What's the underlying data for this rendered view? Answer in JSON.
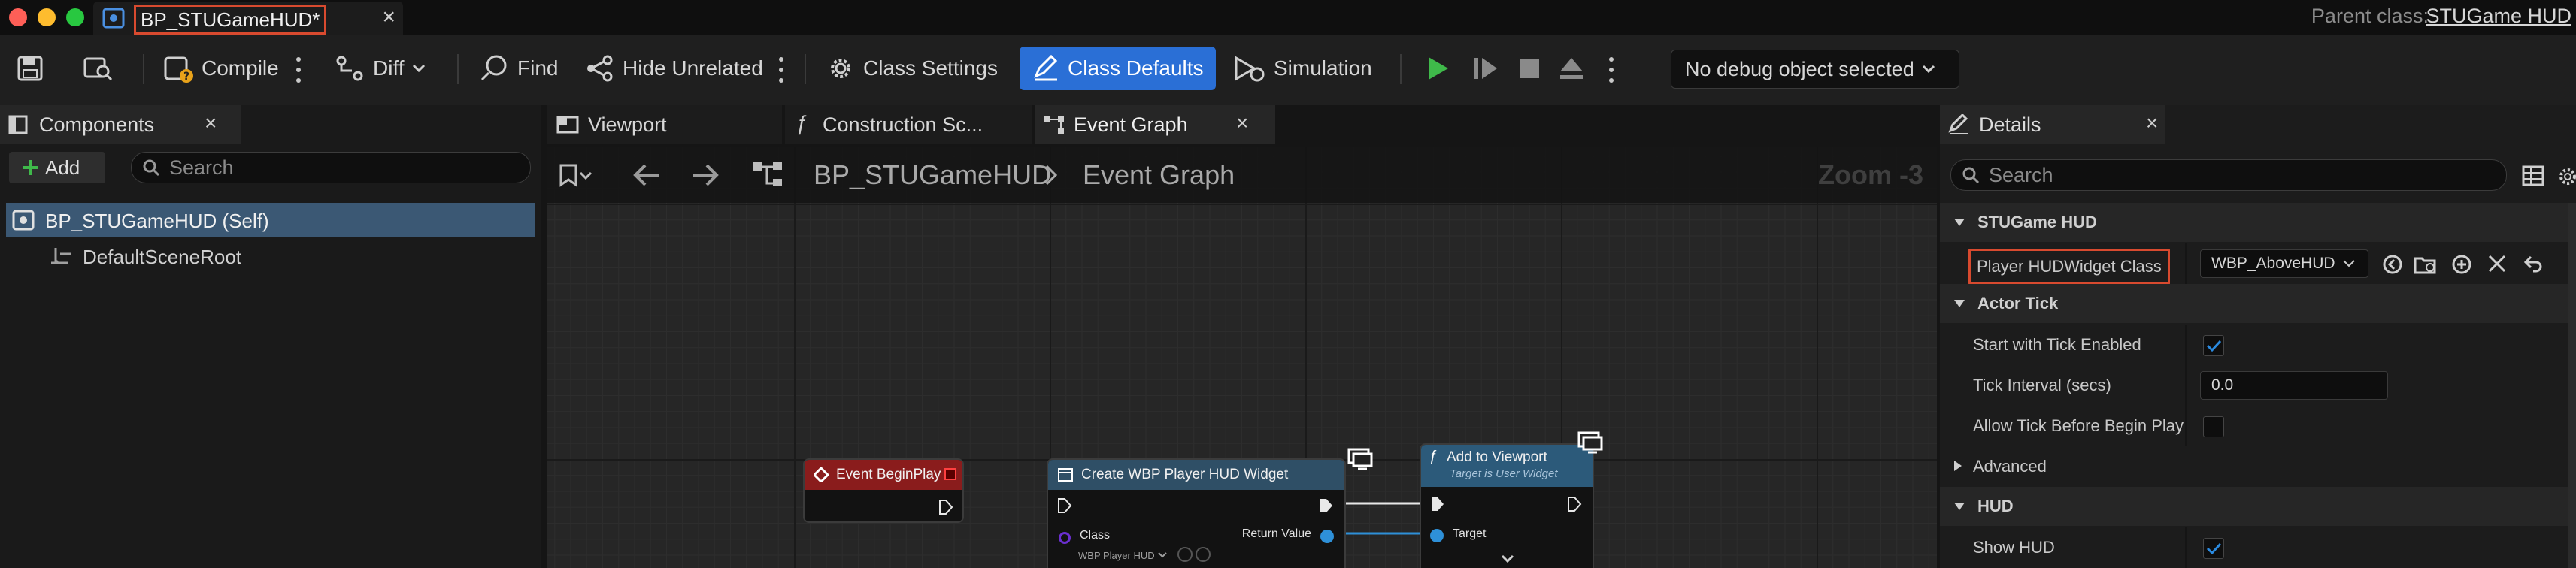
{
  "title_bar": {
    "doc_tab": "BP_STUGameHUD*",
    "tab_close": "×",
    "parent_label": "Parent class:",
    "parent_class": "STUGame HUD"
  },
  "toolbar": {
    "compile": "Compile",
    "diff": "Diff",
    "find": "Find",
    "hide_unrelated": "Hide Unrelated",
    "class_settings": "Class Settings",
    "class_defaults": "Class Defaults",
    "simulation": "Simulation",
    "debug_object": "No debug object selected"
  },
  "components": {
    "tab_label": "Components",
    "add_label": "Add",
    "search_placeholder": "Search",
    "items": [
      "BP_STUGameHUD (Self)",
      "DefaultSceneRoot"
    ]
  },
  "editor_tabs": [
    "Viewport",
    "Construction Sc...",
    "Event Graph"
  ],
  "graph": {
    "breadcrumb_root": "BP_STUGameHUD",
    "breadcrumb_current": "Event Graph",
    "zoom": "Zoom -3",
    "nodes": {
      "begin_play": {
        "title": "Event BeginPlay"
      },
      "create_widget": {
        "title": "Create WBP Player HUD Widget",
        "class_pin": "Class",
        "class_value": "WBP Player HUD",
        "return_pin": "Return Value"
      },
      "add_viewport": {
        "title": "Add to Viewport",
        "subtitle": "Target is User Widget",
        "target_pin": "Target"
      }
    }
  },
  "details": {
    "tab_label": "Details",
    "search_placeholder": "Search",
    "categories": {
      "stugame_hud": "STUGame HUD",
      "actor_tick": "Actor Tick",
      "advanced": "Advanced",
      "hud": "HUD"
    },
    "properties": {
      "player_hud_widget_class": {
        "label": "Player HUDWidget Class",
        "value": "WBP_AboveHUD"
      },
      "start_with_tick": {
        "label": "Start with Tick Enabled",
        "checked": true
      },
      "tick_interval": {
        "label": "Tick Interval (secs)",
        "value": "0.0"
      },
      "allow_tick": {
        "label": "Allow Tick Before Begin Play",
        "checked": false
      },
      "show_hud": {
        "label": "Show HUD",
        "checked": true
      }
    }
  },
  "colors": {
    "accent": "#2a6fd6",
    "highlight_box": "#d84a2f",
    "event_node": "#8a1c1c",
    "function_node": "#2c5a7a"
  }
}
